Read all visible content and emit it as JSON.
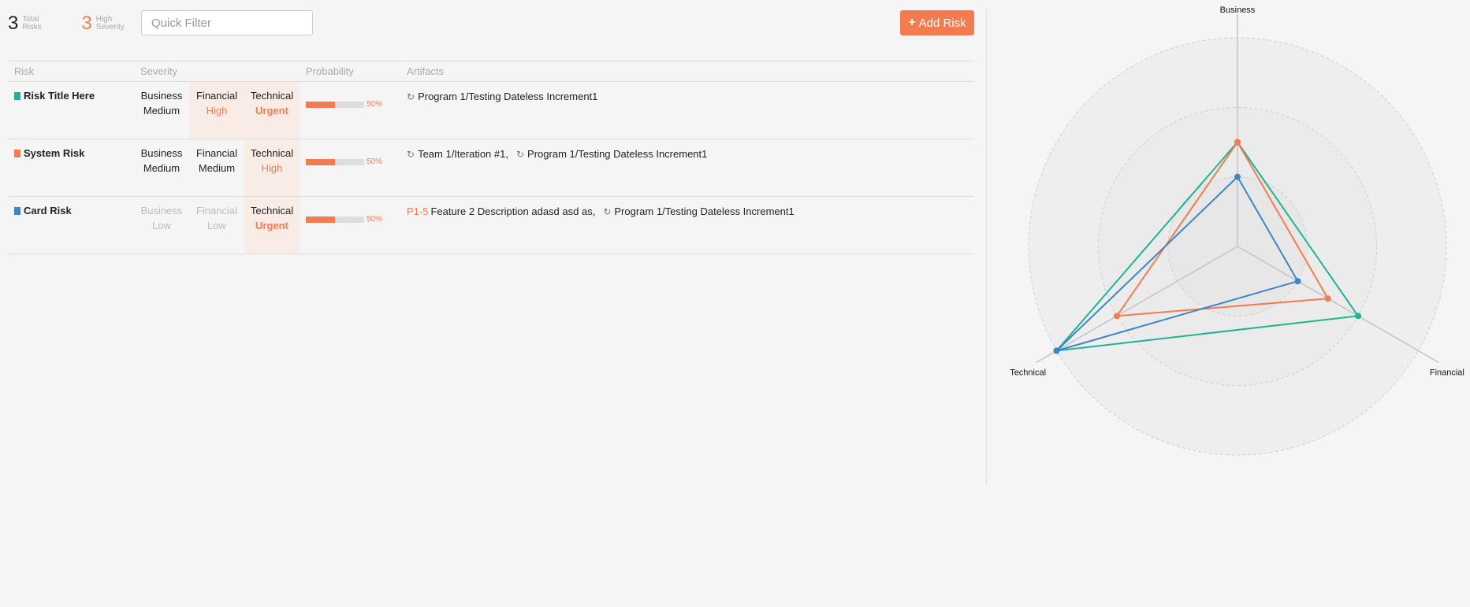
{
  "stats": {
    "total": {
      "value": "3",
      "label_line1": "Total",
      "label_line2": "Risks"
    },
    "high": {
      "value": "3",
      "label_line1": "High",
      "label_line2": "Severity"
    }
  },
  "filter": {
    "placeholder": "Quick Filter",
    "value": ""
  },
  "add_button": {
    "icon": "plus-icon",
    "label": "Add Risk"
  },
  "colors": {
    "accent": "#f47b4f",
    "teal": "#1db394",
    "blue": "#3d86c6"
  },
  "table": {
    "headers": {
      "risk": "Risk",
      "severity": "Severity",
      "probability": "Probability",
      "artifacts": "Artifacts"
    },
    "rows": [
      {
        "name": "Risk Title Here",
        "color": "#1db394",
        "severity": [
          {
            "cat": "Business",
            "level": "Medium",
            "style": "normal"
          },
          {
            "cat": "Financial",
            "level": "High",
            "style": "hi"
          },
          {
            "cat": "Technical",
            "level": "Urgent",
            "style": "hi"
          }
        ],
        "probability": 0.5,
        "probability_label": "50%",
        "artifacts": [
          {
            "icon": "iteration-icon",
            "id": "",
            "text": "Program 1/Testing Dateless Increment1",
            "sep": ""
          }
        ]
      },
      {
        "name": "System Risk",
        "color": "#f47b4f",
        "severity": [
          {
            "cat": "Business",
            "level": "Medium",
            "style": "normal"
          },
          {
            "cat": "Financial",
            "level": "Medium",
            "style": "normal"
          },
          {
            "cat": "Technical",
            "level": "High",
            "style": "hi"
          }
        ],
        "probability": 0.5,
        "probability_label": "50%",
        "artifacts": [
          {
            "icon": "iteration-icon",
            "id": "",
            "text": "Team 1/Iteration #1",
            "sep": ","
          },
          {
            "icon": "iteration-icon",
            "id": "",
            "text": "Program 1/Testing Dateless Increment1",
            "sep": ""
          }
        ]
      },
      {
        "name": "Card Risk",
        "color": "#3d86c6",
        "severity": [
          {
            "cat": "Business",
            "level": "Low",
            "style": "dim"
          },
          {
            "cat": "Financial",
            "level": "Low",
            "style": "dim"
          },
          {
            "cat": "Technical",
            "level": "Urgent",
            "style": "hi"
          }
        ],
        "probability": 0.5,
        "probability_label": "50%",
        "artifacts": [
          {
            "icon": "",
            "id": "P1-5",
            "text": "Feature 2 Description adasd asd as",
            "sep": ","
          },
          {
            "icon": "iteration-icon",
            "id": "",
            "text": "Program 1/Testing Dateless Increment1",
            "sep": ""
          }
        ]
      }
    ]
  },
  "chart_data": {
    "type": "radar",
    "axes": [
      "Business",
      "Financial",
      "Technical"
    ],
    "rmax": 3,
    "grid_levels": 3,
    "series": [
      {
        "name": "Risk Title Here",
        "color": "#1db394",
        "values": [
          1.5,
          2,
          3
        ]
      },
      {
        "name": "System Risk",
        "color": "#f47b4f",
        "values": [
          1.5,
          1.5,
          2
        ]
      },
      {
        "name": "Card Risk",
        "color": "#3d86c6",
        "values": [
          1,
          1,
          3
        ]
      }
    ]
  }
}
